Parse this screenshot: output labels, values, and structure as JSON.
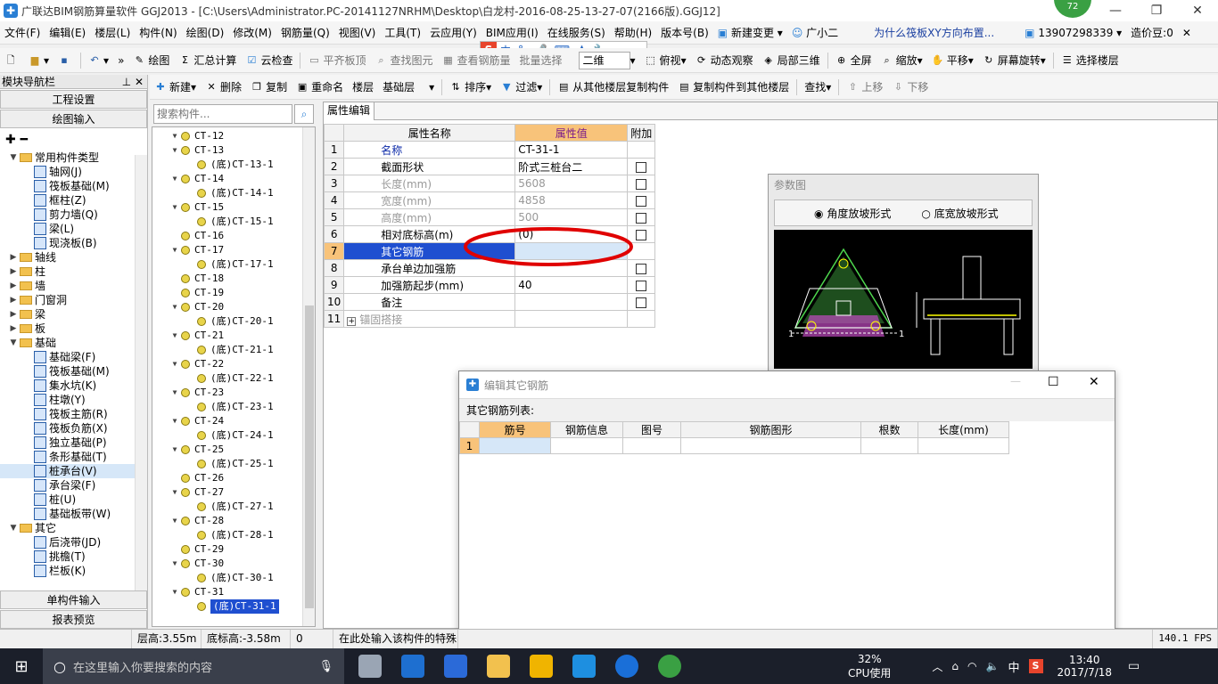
{
  "window": {
    "title": "广联达BIM钢筋算量软件 GGJ2013 - [C:\\Users\\Administrator.PC-20141127NRHM\\Desktop\\白龙村-2016-08-25-13-27-07(2166版).GGJ12]",
    "badge": "72"
  },
  "menu": [
    "文件(F)",
    "编辑(E)",
    "楼层(L)",
    "构件(N)",
    "绘图(D)",
    "修改(M)",
    "钢筋量(Q)",
    "视图(V)",
    "工具(T)",
    "云应用(Y)",
    "BIM应用(I)",
    "在线服务(S)",
    "帮助(H)",
    "版本号(B)"
  ],
  "menu_right": {
    "change": "新建变更",
    "assistant": "广小二",
    "question": "为什么筏板XY方向布置...",
    "phone": "13907298339",
    "cost": "造价豆:0"
  },
  "toolbar1": {
    "draw": "绘图",
    "sum": "汇总计算",
    "cloud_check": "云检查",
    "align_top": "平齐板顶",
    "find_elem": "查找图元",
    "view_rebar": "查看钢筋量",
    "batch_select": "批量选择",
    "view_mode": "二维",
    "view_top": "俯视",
    "dynamic": "动态观察",
    "local3d": "局部三维",
    "fullscreen": "全屏",
    "zoom": "缩放",
    "pan": "平移",
    "rotate": "屏幕旋转",
    "select_floor": "选择楼层"
  },
  "toolbar2": {
    "new": "新建",
    "delete": "删除",
    "copy": "复制",
    "rename": "重命名",
    "floor_label": "楼层",
    "floor_value": "基础层",
    "sort": "排序",
    "filter": "过滤",
    "copy_from": "从其他楼层复制构件",
    "copy_to": "复制构件到其他楼层",
    "find": "查找",
    "up": "上移",
    "down": "下移"
  },
  "nav": {
    "header": "模块导航栏",
    "project_settings": "工程设置",
    "draw_input": "绘图输入",
    "single_input": "单构件输入",
    "report_preview": "报表预览",
    "tree": [
      {
        "type": "folder",
        "label": "常用构件类型",
        "open": true,
        "level": 0
      },
      {
        "type": "item",
        "label": "轴网(J)",
        "level": 1
      },
      {
        "type": "item",
        "label": "筏板基础(M)",
        "level": 1
      },
      {
        "type": "item",
        "label": "框柱(Z)",
        "level": 1
      },
      {
        "type": "item",
        "label": "剪力墙(Q)",
        "level": 1
      },
      {
        "type": "item",
        "label": "梁(L)",
        "level": 1
      },
      {
        "type": "item",
        "label": "现浇板(B)",
        "level": 1
      },
      {
        "type": "folder",
        "label": "轴线",
        "open": false,
        "level": 0
      },
      {
        "type": "folder",
        "label": "柱",
        "open": false,
        "level": 0
      },
      {
        "type": "folder",
        "label": "墙",
        "open": false,
        "level": 0
      },
      {
        "type": "folder",
        "label": "门窗洞",
        "open": false,
        "level": 0
      },
      {
        "type": "folder",
        "label": "梁",
        "open": false,
        "level": 0
      },
      {
        "type": "folder",
        "label": "板",
        "open": false,
        "level": 0
      },
      {
        "type": "folder",
        "label": "基础",
        "open": true,
        "level": 0
      },
      {
        "type": "item",
        "label": "基础梁(F)",
        "level": 1
      },
      {
        "type": "item",
        "label": "筏板基础(M)",
        "level": 1
      },
      {
        "type": "item",
        "label": "集水坑(K)",
        "level": 1
      },
      {
        "type": "item",
        "label": "柱墩(Y)",
        "level": 1
      },
      {
        "type": "item",
        "label": "筏板主筋(R)",
        "level": 1
      },
      {
        "type": "item",
        "label": "筏板负筋(X)",
        "level": 1
      },
      {
        "type": "item",
        "label": "独立基础(P)",
        "level": 1
      },
      {
        "type": "item",
        "label": "条形基础(T)",
        "level": 1
      },
      {
        "type": "item",
        "label": "桩承台(V)",
        "level": 1,
        "selected": true
      },
      {
        "type": "item",
        "label": "承台梁(F)",
        "level": 1
      },
      {
        "type": "item",
        "label": "桩(U)",
        "level": 1
      },
      {
        "type": "item",
        "label": "基础板带(W)",
        "level": 1
      },
      {
        "type": "folder",
        "label": "其它",
        "open": true,
        "level": 0
      },
      {
        "type": "item",
        "label": "后浇带(JD)",
        "level": 1
      },
      {
        "type": "item",
        "label": "挑檐(T)",
        "level": 1
      },
      {
        "type": "item",
        "label": "栏板(K)",
        "level": 1
      }
    ]
  },
  "component": {
    "search_placeholder": "搜索构件...",
    "items": [
      {
        "label": "CT-12",
        "level": 0,
        "exp": "open"
      },
      {
        "label": "CT-13",
        "level": 0,
        "exp": "open"
      },
      {
        "label": "(底)CT-13-1",
        "level": 1
      },
      {
        "label": "CT-14",
        "level": 0,
        "exp": "open"
      },
      {
        "label": "(底)CT-14-1",
        "level": 1
      },
      {
        "label": "CT-15",
        "level": 0,
        "exp": "open"
      },
      {
        "label": "(底)CT-15-1",
        "level": 1
      },
      {
        "label": "CT-16",
        "level": 0
      },
      {
        "label": "CT-17",
        "level": 0,
        "exp": "open"
      },
      {
        "label": "(底)CT-17-1",
        "level": 1
      },
      {
        "label": "CT-18",
        "level": 0
      },
      {
        "label": "CT-19",
        "level": 0
      },
      {
        "label": "CT-20",
        "level": 0,
        "exp": "open"
      },
      {
        "label": "(底)CT-20-1",
        "level": 1
      },
      {
        "label": "CT-21",
        "level": 0,
        "exp": "open"
      },
      {
        "label": "(底)CT-21-1",
        "level": 1
      },
      {
        "label": "CT-22",
        "level": 0,
        "exp": "open"
      },
      {
        "label": "(底)CT-22-1",
        "level": 1
      },
      {
        "label": "CT-23",
        "level": 0,
        "exp": "open"
      },
      {
        "label": "(底)CT-23-1",
        "level": 1
      },
      {
        "label": "CT-24",
        "level": 0,
        "exp": "open"
      },
      {
        "label": "(底)CT-24-1",
        "level": 1
      },
      {
        "label": "CT-25",
        "level": 0,
        "exp": "open"
      },
      {
        "label": "(底)CT-25-1",
        "level": 1
      },
      {
        "label": "CT-26",
        "level": 0
      },
      {
        "label": "CT-27",
        "level": 0,
        "exp": "open"
      },
      {
        "label": "(底)CT-27-1",
        "level": 1
      },
      {
        "label": "CT-28",
        "level": 0,
        "exp": "open"
      },
      {
        "label": "(底)CT-28-1",
        "level": 1
      },
      {
        "label": "CT-29",
        "level": 0
      },
      {
        "label": "CT-30",
        "level": 0,
        "exp": "open"
      },
      {
        "label": "(底)CT-30-1",
        "level": 1
      },
      {
        "label": "CT-31",
        "level": 0,
        "exp": "open"
      },
      {
        "label": "(底)CT-31-1",
        "level": 1,
        "selected": true
      }
    ]
  },
  "props": {
    "tab": "属性编辑",
    "col_name": "属性名称",
    "col_value": "属性值",
    "col_extra": "附加",
    "rows": [
      {
        "no": "1",
        "name": "名称",
        "value": "CT-31-1",
        "style": "blue",
        "check": false
      },
      {
        "no": "2",
        "name": "截面形状",
        "value": "阶式三桩台二",
        "style": "",
        "check": true
      },
      {
        "no": "3",
        "name": "长度(mm)",
        "value": "5608",
        "style": "gray",
        "check": true
      },
      {
        "no": "4",
        "name": "宽度(mm)",
        "value": "4858",
        "style": "gray",
        "check": true
      },
      {
        "no": "5",
        "name": "高度(mm)",
        "value": "500",
        "style": "gray",
        "check": true
      },
      {
        "no": "6",
        "name": "相对底标高(m)",
        "value": "(0)",
        "style": "",
        "check": true
      },
      {
        "no": "7",
        "name": "其它钢筋",
        "value": "",
        "style": "selected",
        "check": false
      },
      {
        "no": "8",
        "name": "承台单边加强筋",
        "value": "",
        "style": "",
        "check": true
      },
      {
        "no": "9",
        "name": "加强筋起步(mm)",
        "value": "40",
        "style": "",
        "check": true
      },
      {
        "no": "10",
        "name": "备注",
        "value": "",
        "style": "",
        "check": true
      },
      {
        "no": "11",
        "name": "锚固搭接",
        "value": "",
        "style": "group",
        "check": false
      }
    ]
  },
  "param": {
    "title": "参数图",
    "option_angle": "角度放坡形式",
    "option_width": "底宽放坡形式",
    "selected": "angle",
    "label_1": "1"
  },
  "dialog": {
    "title": "编辑其它钢筋",
    "list_label": "其它钢筋列表:",
    "columns": [
      "筋号",
      "钢筋信息",
      "图号",
      "钢筋图形",
      "根数",
      "长度(mm)"
    ],
    "row_no": "1"
  },
  "status": {
    "floor_height": "层高:3.55m",
    "bottom_elev": "底标高:-3.58m",
    "zero": "0",
    "hint": "在此处输入该构件的特殊",
    "fps": "140.1 FPS"
  },
  "taskbar": {
    "search_placeholder": "在这里输入你要搜索的内容",
    "cpu_percent": "32%",
    "cpu_label": "CPU使用",
    "ime": "中",
    "time": "13:40",
    "date": "2017/7/18"
  },
  "colors": {
    "accent_orange": "#f8c37a",
    "selection_blue": "#d6e7f8",
    "annotation_red": "#e00000",
    "taskbar": "#1b1f2a"
  }
}
